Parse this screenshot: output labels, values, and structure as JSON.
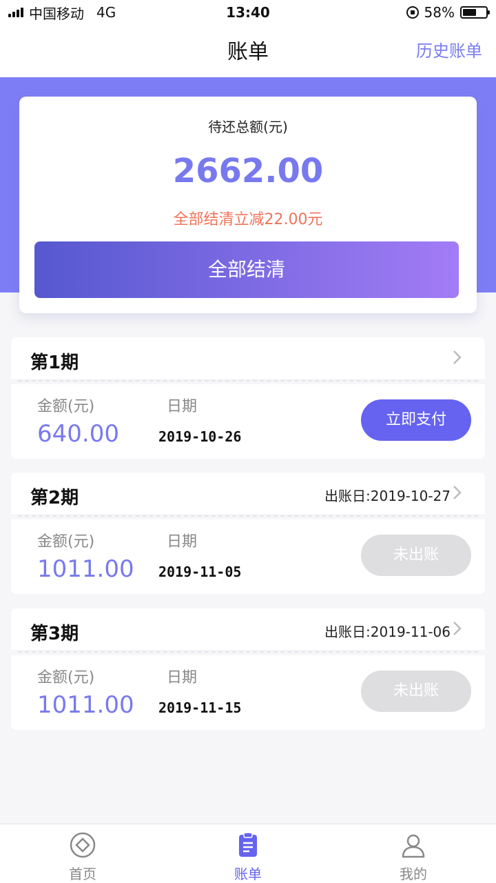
{
  "status_bar": {
    "carrier": "中国移动",
    "network": "4G",
    "time": "13:40",
    "battery": "58%",
    "battery_level": 0.58
  },
  "nav": {
    "title": "账单",
    "history_link": "历史账单"
  },
  "summary": {
    "label": "待还总额(元)",
    "amount": "2662.00",
    "discount_text": "全部结清立减22.00元",
    "settle_button": "全部结清"
  },
  "installments": [
    {
      "title": "第1期",
      "statement_date": "",
      "amount_label": "金额(元)",
      "date_label": "日期",
      "amount": "640.00",
      "due_date": "2019-10-26",
      "action": "立即支付",
      "active": true
    },
    {
      "title": "第2期",
      "statement_date": "出账日:2019-10-27",
      "amount_label": "金额(元)",
      "date_label": "日期",
      "amount": "1011.00",
      "due_date": "2019-11-05",
      "action": "未出账",
      "active": false
    },
    {
      "title": "第3期",
      "statement_date": "出账日:2019-11-06",
      "amount_label": "金额(元)",
      "date_label": "日期",
      "amount": "1011.00",
      "due_date": "2019-11-15",
      "action": "未出账",
      "active": false
    }
  ],
  "tabs": [
    {
      "label": "首页",
      "icon": "home-diamond-icon",
      "active": false
    },
    {
      "label": "账单",
      "icon": "bill-clipboard-icon",
      "active": true
    },
    {
      "label": "我的",
      "icon": "user-profile-icon",
      "active": false
    }
  ],
  "colors": {
    "accent": "#7879ee",
    "band": "#7d7ef5",
    "discount": "#f0735b",
    "pay_button": "#6563f0",
    "disabled_button": "#dedee0"
  }
}
